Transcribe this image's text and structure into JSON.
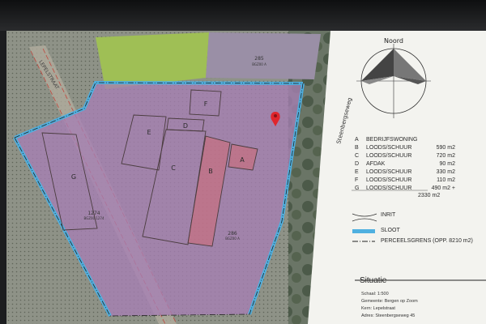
{
  "compass": {
    "label": "Noord"
  },
  "map": {
    "road_left": "LEPELSTRAAT",
    "road_right": "Steenbergseweg",
    "parcel_top": "285",
    "parcel_top_sub": "BGZ00 A",
    "parcel_left": "1274",
    "parcel_left_sub": "BGZ00 1274",
    "parcel_main": "286",
    "parcel_main_sub": "BGZ00 A",
    "buildings": [
      "F",
      "D",
      "E",
      "C",
      "B",
      "A",
      "G"
    ]
  },
  "legend": {
    "items": [
      {
        "letter": "A",
        "name": "BEDRIJFSWONING",
        "value": ""
      },
      {
        "letter": "B",
        "name": "LOODS/SCHUUR",
        "value": "590 m2"
      },
      {
        "letter": "C",
        "name": "LOODS/SCHUUR",
        "value": "720 m2"
      },
      {
        "letter": "D",
        "name": "AFDAK",
        "value": "90 m2"
      },
      {
        "letter": "E",
        "name": "LOODS/SCHUUR",
        "value": "330 m2"
      },
      {
        "letter": "F",
        "name": "LOODS/SCHUUR",
        "value": "110 m2"
      },
      {
        "letter": "G",
        "name": "LOODS/SCHUUR",
        "value": "490 m2 +"
      }
    ],
    "total": "2330 m2",
    "inrit": "INRIT",
    "sloot": "SLOOT",
    "perceelsgrens": "PERCEELSGRENS (OPP. 8210 m2)"
  },
  "situatie": {
    "title": "Situatie",
    "schaal": "Schaal: 1:500",
    "gemeente": "Gemeente: Bergen op Zoom",
    "kern": "Kern: Lepelstraat",
    "adres": "Adres: Steenbergseweg 45"
  },
  "colors": {
    "parcel": "#a77fb4",
    "ditch": "#4fb0e0",
    "pin": "#e0262c"
  }
}
